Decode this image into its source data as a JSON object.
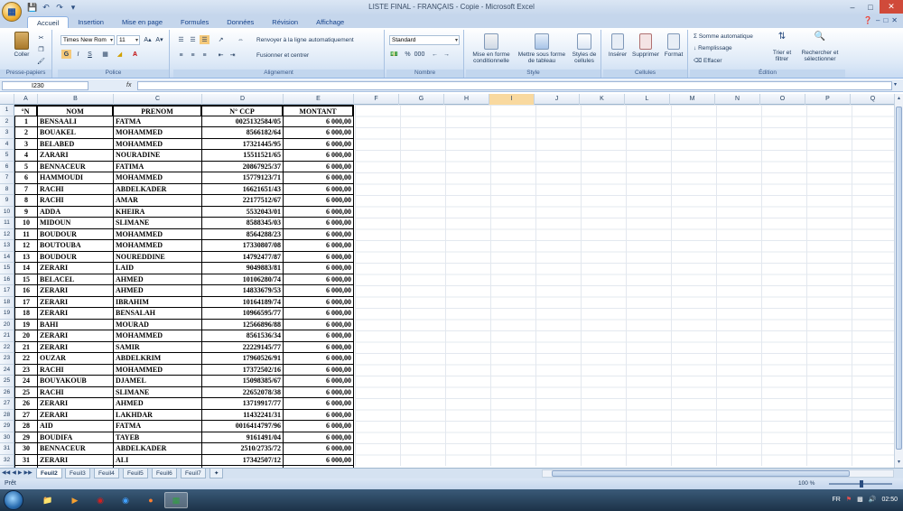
{
  "window": {
    "title": "LISTE FINAL - FRANÇAIS - Copie - Microsoft Excel"
  },
  "ribbon_tabs": [
    "Accueil",
    "Insertion",
    "Mise en page",
    "Formules",
    "Données",
    "Révision",
    "Affichage"
  ],
  "ribbon": {
    "clipboard": {
      "paste": "Coller",
      "label": "Presse-papiers"
    },
    "font": {
      "name": "Times New Rom",
      "size": "11",
      "label": "Police"
    },
    "alignment": {
      "wrap": "Renvoyer à la ligne automatiquement",
      "merge": "Fusionner et centrer",
      "label": "Alignement"
    },
    "number": {
      "format": "Standard",
      "label": "Nombre"
    },
    "style": {
      "cond": "Mise en forme conditionnelle",
      "table": "Mettre sous forme de tableau",
      "cells": "Styles de cellules",
      "label": "Style"
    },
    "cells": {
      "insert": "Insérer",
      "delete": "Supprimer",
      "format": "Format",
      "label": "Cellules"
    },
    "editing": {
      "autosum": "Somme automatique",
      "fill": "Remplissage",
      "clear": "Effacer",
      "sort": "Trier et filtrer",
      "find": "Rechercher et sélectionner",
      "label": "Édition"
    }
  },
  "formula_bar": {
    "cell_ref": "I230",
    "fx": "fx",
    "value": ""
  },
  "columns": [
    "A",
    "B",
    "C",
    "D",
    "E",
    "F",
    "G",
    "H",
    "I",
    "J",
    "K",
    "L",
    "M",
    "N",
    "O",
    "P",
    "Q"
  ],
  "header_row": [
    "°N",
    "NOM",
    "PRENOM",
    "N° CCP",
    "MONTANT"
  ],
  "rows": [
    [
      "1",
      "BENSAALI",
      "FATMA",
      "0025132584/05",
      "6 000,00"
    ],
    [
      "2",
      "BOUAKEL",
      "MOHAMMED",
      "8566182/64",
      "6 000,00"
    ],
    [
      "3",
      "BELABED",
      "MOHAMMED",
      "17321445/95",
      "6 000,00"
    ],
    [
      "4",
      "ZARARI",
      "NOURADINE",
      "15511521/65",
      "6 000,00"
    ],
    [
      "5",
      "BENNACEUR",
      "FATIMA",
      "20867925/37",
      "6 000,00"
    ],
    [
      "6",
      "HAMMOUDI",
      "MOHAMMED",
      "15779123/71",
      "6 000,00"
    ],
    [
      "7",
      "RACHI",
      "ABDELKADER",
      "16621651/43",
      "6 000,00"
    ],
    [
      "8",
      "RACHI",
      "AMAR",
      "22177512/67",
      "6 000,00"
    ],
    [
      "9",
      "ADDA",
      "KHEIRA",
      "5532043/01",
      "6 000,00"
    ],
    [
      "10",
      "MIDOUN",
      "SLIMANE",
      "8588345/03",
      "6 000,00"
    ],
    [
      "11",
      "BOUDOUR",
      "MOHAMMED",
      "8564288/23",
      "6 000,00"
    ],
    [
      "12",
      "BOUTOUBA",
      "MOHAMMED",
      "17330807/08",
      "6 000,00"
    ],
    [
      "13",
      "BOUDOUR",
      "NOUREDDINE",
      "14792477/87",
      "6 000,00"
    ],
    [
      "14",
      "ZERARI",
      "LAID",
      "9049883/81",
      "6 000,00"
    ],
    [
      "15",
      "BELACEL",
      "AHMED",
      "10106280/74",
      "6 000,00"
    ],
    [
      "16",
      "ZERARI",
      "AHMED",
      "14833679/53",
      "6 000,00"
    ],
    [
      "17",
      "ZERARI",
      "IBRAHIM",
      "10164189/74",
      "6 000,00"
    ],
    [
      "18",
      "ZERARI",
      "BENSALAH",
      "10966595/77",
      "6 000,00"
    ],
    [
      "19",
      "BAHI",
      "MOURAD",
      "12566896/88",
      "6 000,00"
    ],
    [
      "20",
      "ZERARI",
      "MOHAMMED",
      "8561536/34",
      "6 000,00"
    ],
    [
      "21",
      "ZERARI",
      "SAMIR",
      "22229145/77",
      "6 000,00"
    ],
    [
      "22",
      "OUZAR",
      "ABDELKRIM",
      "17960526/91",
      "6 000,00"
    ],
    [
      "23",
      "RACHI",
      "MOHAMMED",
      "17372502/16",
      "6 000,00"
    ],
    [
      "24",
      "BOUYAKOUB",
      "DJAMEL",
      "15098385/67",
      "6 000,00"
    ],
    [
      "25",
      "RACHI",
      "SLIMANE",
      "22652078/38",
      "6 000,00"
    ],
    [
      "26",
      "ZERARI",
      "AHMED",
      "13719917/77",
      "6 000,00"
    ],
    [
      "27",
      "ZERARI",
      "LAKHDAR",
      "11432241/31",
      "6 000,00"
    ],
    [
      "28",
      "AID",
      "FATMA",
      "0016414797/96",
      "6 000,00"
    ],
    [
      "29",
      "BOUDIFA",
      "TAYEB",
      "9161491/04",
      "6 000,00"
    ],
    [
      "30",
      "BENNACEUR",
      "ABDELKADER",
      "2510/2735/72",
      "6 000,00"
    ],
    [
      "31",
      "ZERARI",
      "ALI",
      "17342507/12",
      "6 000,00"
    ]
  ],
  "sheet_tabs": [
    "Feuil2",
    "Feuil3",
    "Feuil4",
    "Feuil5",
    "Feuil6",
    "Feuil7"
  ],
  "status": {
    "ready": "Prêt",
    "zoom": "100 %"
  },
  "tray": {
    "lang": "FR",
    "time": "02:50"
  }
}
